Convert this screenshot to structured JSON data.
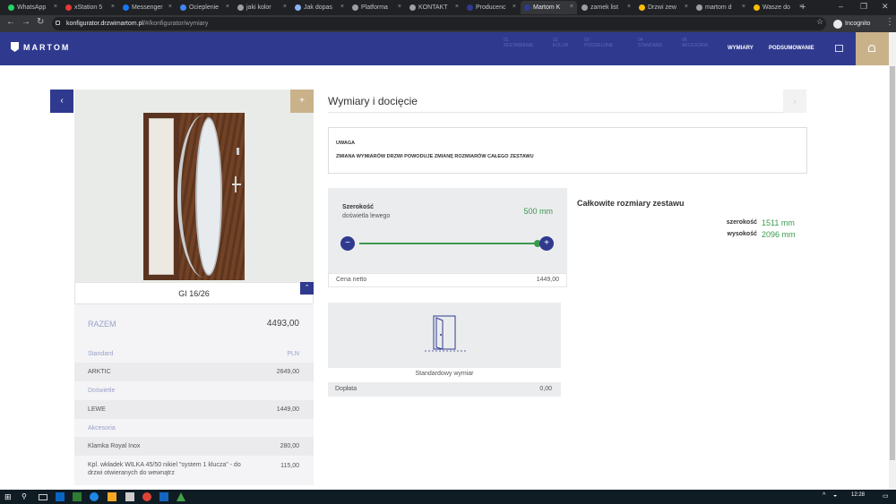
{
  "browser": {
    "tabs": [
      {
        "label": "WhatsApp",
        "color": "#25d366"
      },
      {
        "label": "xStation 5",
        "color": "#e53935"
      },
      {
        "label": "Messenger",
        "color": "#1877f2"
      },
      {
        "label": "Ocieplenie",
        "color": "#4285f4"
      },
      {
        "label": "jaki kolor",
        "color": "#9aa0a6"
      },
      {
        "label": "Jak dopas",
        "color": "#8ab4f8"
      },
      {
        "label": "Platforma",
        "color": "#9aa0a6"
      },
      {
        "label": "KONTAKT",
        "color": "#9aa0a6"
      },
      {
        "label": "Producenc",
        "color": "#2f3a8f"
      },
      {
        "label": "Martom K",
        "color": "#2f3a8f",
        "active": true
      },
      {
        "label": "zamek list",
        "color": "#9aa0a6"
      },
      {
        "label": "Drzwi zew",
        "color": "#fbbc04"
      },
      {
        "label": "martom d",
        "color": "#9aa0a6"
      },
      {
        "label": "Wasze do",
        "color": "#fbbc04"
      }
    ],
    "url_host": "konfigurator.drzwimartom.pl",
    "url_path": "/#/konfigurator/wymiary",
    "incognito_label": "Incognito"
  },
  "header": {
    "logo": "MARTOM",
    "steps": [
      {
        "num": "01",
        "label": "ZESTAWIENIE"
      },
      {
        "num": "02",
        "label": "KOLOR"
      },
      {
        "num": "03",
        "label": "PODZIELONE"
      },
      {
        "num": "04",
        "label": "STANDARD"
      },
      {
        "num": "05",
        "label": "AKCESORIA"
      }
    ],
    "current_step": "WYMIARY",
    "summary_step": "PODSUMOWANIE"
  },
  "product": {
    "model": "GI 16/26",
    "total_label": "RAZEM",
    "total_value": "4493,00",
    "rows": [
      {
        "label": "Standard",
        "value": "PLN",
        "type": "head"
      },
      {
        "label": "ARKTIC",
        "value": "2649,00",
        "type": "item"
      },
      {
        "label": "Doświetle",
        "value": "",
        "type": "head"
      },
      {
        "label": "LEWE",
        "value": "1449,00",
        "type": "item"
      },
      {
        "label": "Akcesoria",
        "value": "",
        "type": "head"
      },
      {
        "label": "Klamka Royal Inox",
        "value": "280,00",
        "type": "item"
      },
      {
        "label": "Kpl. wkładek WILKA 45/50 nikiel \"system 1 klucza\" - do drzwi otwieranych do wewnątrz",
        "value": "115,00",
        "type": "item"
      }
    ]
  },
  "main": {
    "title": "Wymiary i docięcie",
    "notice_title": "UWAGA",
    "notice_text": "ZMIANA WYMIARÓW DRZWI POWODUJE ZMIANĘ ROZMIARÓW CAŁEGO ZESTAWU",
    "width_label": "Szerokość",
    "width_sub": "doświetla lewego",
    "width_value": "500 mm",
    "slider_level": 1.0,
    "net_label": "Cena netto",
    "net_value": "1449,00",
    "std_label": "Standardowy wymiar",
    "surcharge_label": "Dopłata",
    "surcharge_value": "0,00",
    "dims_title": "Całkowite rozmiary zestawu",
    "dims_w_label": "szerokość",
    "dims_w_value": "1511 mm",
    "dims_h_label": "wysokość",
    "dims_h_value": "2096 mm"
  },
  "taskbar": {
    "time": "12:28"
  }
}
